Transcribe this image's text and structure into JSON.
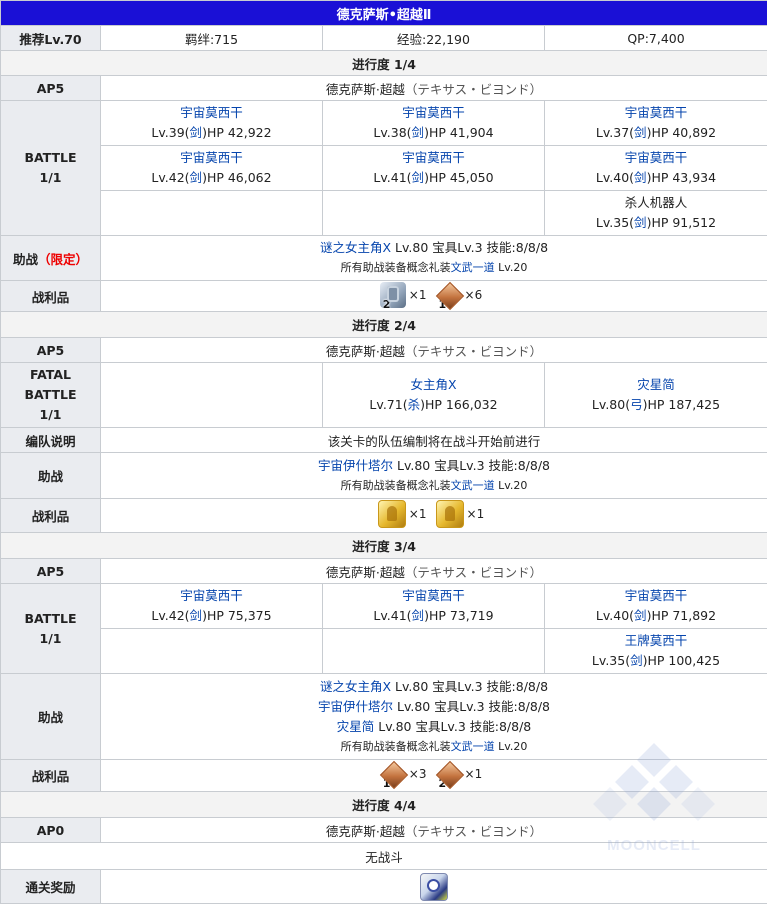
{
  "title": "德克萨斯•超越Ⅱ",
  "info": {
    "recommend": "推荐Lv.70",
    "bond": "羁绊:715",
    "exp": "经验:22,190",
    "qp": "QP:7,400"
  },
  "labels": {
    "ap": "AP5",
    "ap_final": "AP0",
    "battle_line1": "BATTLE",
    "battle_line2": "1/1",
    "fatal": "FATAL",
    "support": "助战",
    "limited": "（限定）",
    "drops": "战利品",
    "formation": "编队说明",
    "clear_reward": "通关奖励",
    "times": "×"
  },
  "quest_name": "德克萨斯·超越",
  "quest_name_jp": "（テキサス・ビヨンド）",
  "sections": {
    "s1": "进行度 1/4",
    "s2": "进行度 2/4",
    "s3": "进行度 3/4",
    "s4": "进行度 4/4"
  },
  "phase1": {
    "enemies": [
      [
        {
          "name": "宇宙莫西干",
          "lv": "Lv.39(",
          "cls": "剑",
          "hp": ")HP 42,922"
        },
        {
          "name": "宇宙莫西干",
          "lv": "Lv.38(",
          "cls": "剑",
          "hp": ")HP 41,904"
        },
        {
          "name": "宇宙莫西干",
          "lv": "Lv.37(",
          "cls": "剑",
          "hp": ")HP 40,892"
        }
      ],
      [
        {
          "name": "宇宙莫西干",
          "lv": "Lv.42(",
          "cls": "剑",
          "hp": ")HP 46,062"
        },
        {
          "name": "宇宙莫西干",
          "lv": "Lv.41(",
          "cls": "剑",
          "hp": ")HP 45,050"
        },
        {
          "name": "宇宙莫西干",
          "lv": "Lv.40(",
          "cls": "剑",
          "hp": ")HP 43,934"
        }
      ],
      [
        {
          "name": "杀人机器人",
          "lv": "Lv.35(",
          "cls": "剑",
          "hp": ")HP 91,512"
        }
      ]
    ],
    "support": {
      "servant": "谜之女主角X",
      "detail": " Lv.80 宝具Lv.3 技能:8/8/8"
    },
    "ce_prefix": "所有助战装备概念礼装",
    "ce_name": "文武一道",
    "ce_level": " Lv.20",
    "drops": [
      {
        "icon": "gear-item-icon",
        "badge": "2",
        "count": "1"
      },
      {
        "icon": "bronze-item-icon",
        "badge": "1",
        "count": "6"
      }
    ]
  },
  "phase2": {
    "enemies": [
      {
        "name": "女主角X",
        "lv": "Lv.71(",
        "cls": "杀",
        "hp": ")HP 166,032"
      },
      {
        "name": "灾星简",
        "lv": "Lv.80(",
        "cls": "弓",
        "hp": ")HP 187,425"
      }
    ],
    "formation_note": "该关卡的队伍编制将在战斗开始前进行",
    "support": {
      "servant": "宇宙伊什塔尔",
      "detail": " Lv.80 宝具Lv.3 技能:8/8/8"
    },
    "drops": [
      {
        "icon": "gold-item-icon",
        "count": "1"
      },
      {
        "icon": "gold-item-icon",
        "count": "1"
      }
    ]
  },
  "phase3": {
    "enemies": [
      [
        {
          "name": "宇宙莫西干",
          "lv": "Lv.42(",
          "cls": "剑",
          "hp": ")HP 75,375"
        },
        {
          "name": "宇宙莫西干",
          "lv": "Lv.41(",
          "cls": "剑",
          "hp": ")HP 73,719"
        },
        {
          "name": "宇宙莫西干",
          "lv": "Lv.40(",
          "cls": "剑",
          "hp": ")HP 71,892"
        }
      ],
      [
        {
          "name": "王牌莫西干",
          "lv": "Lv.35(",
          "cls": "剑",
          "hp": ")HP 100,425"
        }
      ]
    ],
    "supports": [
      {
        "servant": "谜之女主角X",
        "detail": " Lv.80 宝具Lv.3 技能:8/8/8"
      },
      {
        "servant": "宇宙伊什塔尔",
        "detail": " Lv.80 宝具Lv.3 技能:8/8/8"
      },
      {
        "servant": "灾星简",
        "detail": " Lv.80 宝具Lv.3 技能:8/8/8"
      }
    ],
    "drops": [
      {
        "icon": "bronze-item-icon",
        "badge": "1",
        "count": "3"
      },
      {
        "icon": "bronze-item-icon",
        "badge": "2",
        "count": "1"
      }
    ]
  },
  "phase4": {
    "no_battle": "无战斗"
  },
  "watermark": "MOONCELL",
  "colors": {
    "title_bg": "#1a10d6",
    "link": "#0645ad",
    "limited": "#ee0000",
    "header_bg": "#eaecf0"
  }
}
